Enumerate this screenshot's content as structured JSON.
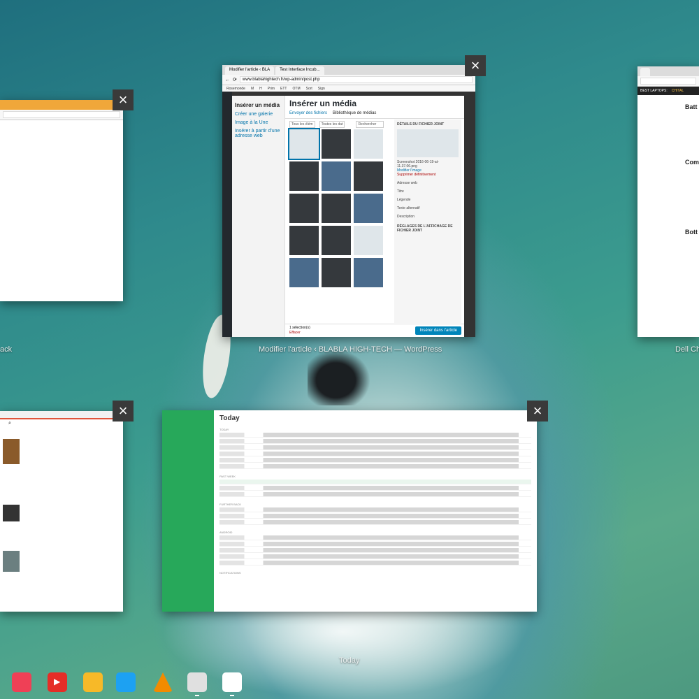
{
  "overview": {
    "windows": [
      {
        "id": "left-top",
        "title": "ack"
      },
      {
        "id": "wordpress",
        "title": "Modifier l'article ‹ BLABLA HIGH-TECH — WordPress",
        "tabs": [
          "Modifier l'article ‹ BLA",
          "Test Interface Incub..."
        ],
        "url": "www.blablahightech.fr/wp-admin/post.php",
        "bookmarks": [
          "Rosemonde",
          "M",
          "H",
          "Prim",
          "ETT",
          "OTM",
          "Sort",
          "Sign"
        ],
        "modal": {
          "left_items": [
            "Insérer un média",
            "Créer une galerie",
            "Image à la Une",
            "Insérer à partir d'une adresse web"
          ],
          "heading": "Insérer un média",
          "tabs": [
            "Envoyer des fichiers",
            "Bibliothèque de médias"
          ],
          "filters": [
            "Tous les élém",
            "Toutes les dat",
            "Rechercher"
          ],
          "details_title": "DÉTAILS DU FICHIER JOINT",
          "file_name": "Screenshot 2016-06-19-at-11.37.06.png",
          "edit_link": "Modifier l'image",
          "delete_link": "Supprimer définitivement",
          "fields": [
            "Adresse web",
            "Titre",
            "Légende",
            "Texte alternatif",
            "Description"
          ],
          "settings_title": "RÉGLAGES DE L'AFFICHAGE DE FICHIER JOINT",
          "selection": "1 sélection(s)",
          "clear": "Effacer",
          "insert_button": "Insérer dans l'article"
        }
      },
      {
        "id": "dell",
        "title": "Dell Ch",
        "bookmarks": [
          "BEST LAPTOPS:",
          "CHITAL"
        ],
        "headings": [
          "Batt",
          "Com",
          "Bott"
        ]
      },
      {
        "id": "left-bottom",
        "title": ""
      },
      {
        "id": "today",
        "title": "Today",
        "heading": "Today",
        "sections": [
          "TODAY",
          "PAST WEEK",
          "FURTHER BACK",
          "PAST MONTH",
          "ANDROID",
          "NOTIFICATIONS"
        ]
      }
    ],
    "close_glyph": "×"
  },
  "shelf": {
    "apps": [
      {
        "name": "pocket-icon",
        "color": "#ef4056"
      },
      {
        "name": "youtube-icon",
        "color": "#e52d27"
      },
      {
        "name": "keep-icon",
        "color": "#f7b928"
      },
      {
        "name": "twitter-icon",
        "color": "#1da1f2"
      },
      {
        "name": "vlc-icon",
        "color": "#f28b00"
      },
      {
        "name": "chrome-window-icon",
        "color": "#e0e0e0"
      },
      {
        "name": "slack-icon",
        "color": "#ffffff"
      }
    ]
  }
}
